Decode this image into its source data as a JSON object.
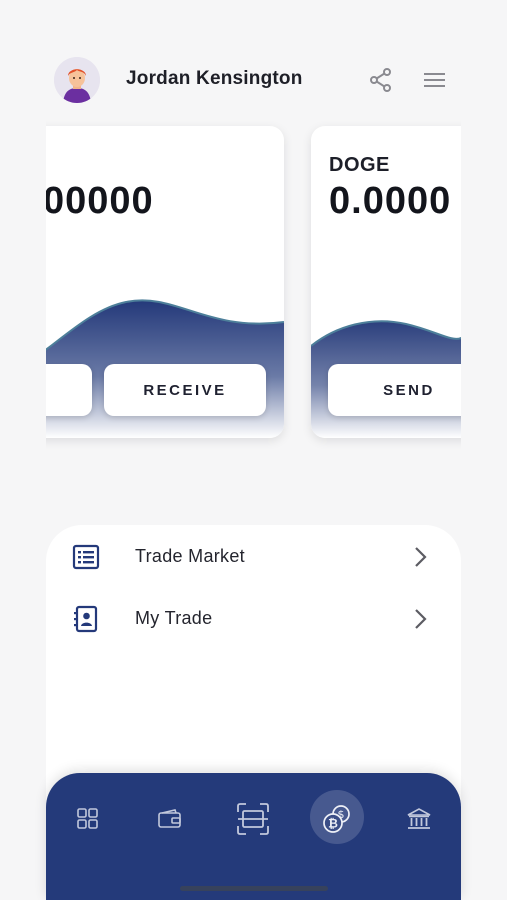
{
  "header": {
    "user_name": "Jordan Kensington"
  },
  "cards": [
    {
      "balance": "00000",
      "buttons": [
        "",
        "RECEIVE"
      ]
    },
    {
      "coin": "DOGE",
      "balance": "0.0000",
      "buttons": [
        "SEND"
      ]
    }
  ],
  "menu": [
    {
      "label": "Trade Market",
      "icon": "list-icon"
    },
    {
      "label": "My Trade",
      "icon": "contact-book-icon"
    }
  ],
  "bottom_nav": {
    "items": [
      "dashboard-icon",
      "wallet-icon",
      "scan-icon",
      "crypto-coins-icon",
      "bank-icon"
    ],
    "active_index": 3
  },
  "colors": {
    "primary": "#243a7a",
    "wave_top": "#24397a",
    "background": "#f6f6f7"
  }
}
